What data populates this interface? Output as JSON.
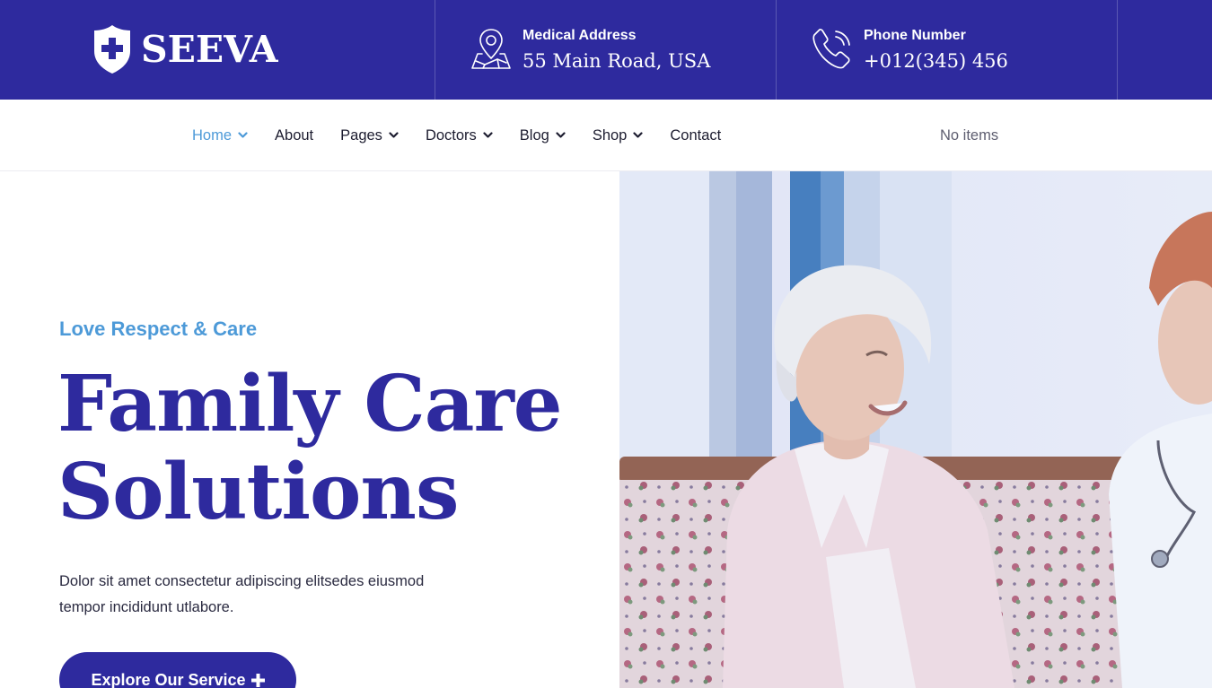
{
  "brand": {
    "name": "SEEVA",
    "logo_icon": "shield-cross-icon"
  },
  "header": {
    "address": {
      "label": "Medical Address",
      "value": "55 Main Road, USA",
      "icon": "map-pin-icon"
    },
    "phone": {
      "label": "Phone Number",
      "value": "+012(345) 456",
      "icon": "phone-icon"
    }
  },
  "nav": {
    "items": [
      {
        "label": "Home",
        "has_dropdown": true,
        "active": true
      },
      {
        "label": "About",
        "has_dropdown": false
      },
      {
        "label": "Pages",
        "has_dropdown": true
      },
      {
        "label": "Doctors",
        "has_dropdown": true
      },
      {
        "label": "Blog",
        "has_dropdown": true
      },
      {
        "label": "Shop",
        "has_dropdown": true
      },
      {
        "label": "Contact",
        "has_dropdown": false
      }
    ],
    "cart_text": "No items"
  },
  "hero": {
    "eyebrow": "Love Respect & Care",
    "title_line1": "Family Care",
    "title_line2": "Solutions",
    "description": "Dolor sit amet consectetur adipiscing elitsedes eiusmod tempor incididunt utlabore.",
    "cta_label": "Explore Our Service",
    "cta_icon": "plus-icon",
    "image": "elderly-woman-with-nurse-photo"
  },
  "colors": {
    "primary": "#2e2a9e",
    "accent": "#4d9ad8",
    "text": "#1d1d30",
    "muted": "#5e5e70"
  }
}
